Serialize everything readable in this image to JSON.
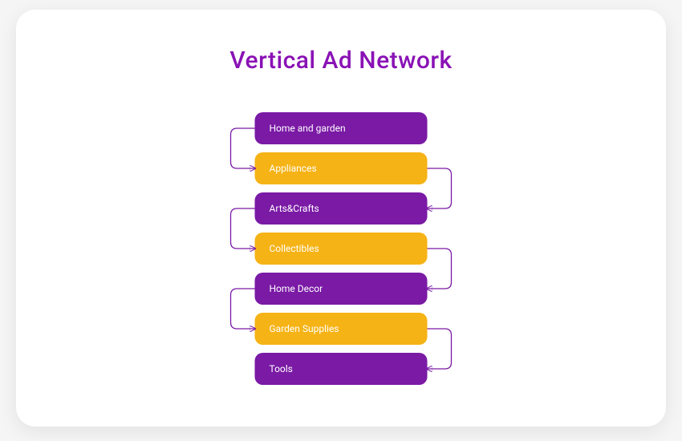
{
  "title": "Vertical Ad Network",
  "colors": {
    "purple": "#7a1aa5",
    "orange": "#f5b316",
    "title": "#8a12b5"
  },
  "nodes": [
    {
      "label": "Home and garden",
      "color": "purple"
    },
    {
      "label": "Appliances",
      "color": "orange"
    },
    {
      "label": "Arts&Crafts",
      "color": "purple"
    },
    {
      "label": "Collectibles",
      "color": "orange"
    },
    {
      "label": "Home Decor",
      "color": "purple"
    },
    {
      "label": "Garden Supplies",
      "color": "orange"
    },
    {
      "label": "Tools",
      "color": "purple"
    }
  ],
  "connections": [
    {
      "from": 0,
      "to": 1,
      "side": "left"
    },
    {
      "from": 1,
      "to": 2,
      "side": "right"
    },
    {
      "from": 2,
      "to": 3,
      "side": "left"
    },
    {
      "from": 3,
      "to": 4,
      "side": "right"
    },
    {
      "from": 4,
      "to": 5,
      "side": "left"
    },
    {
      "from": 5,
      "to": 6,
      "side": "right"
    }
  ]
}
